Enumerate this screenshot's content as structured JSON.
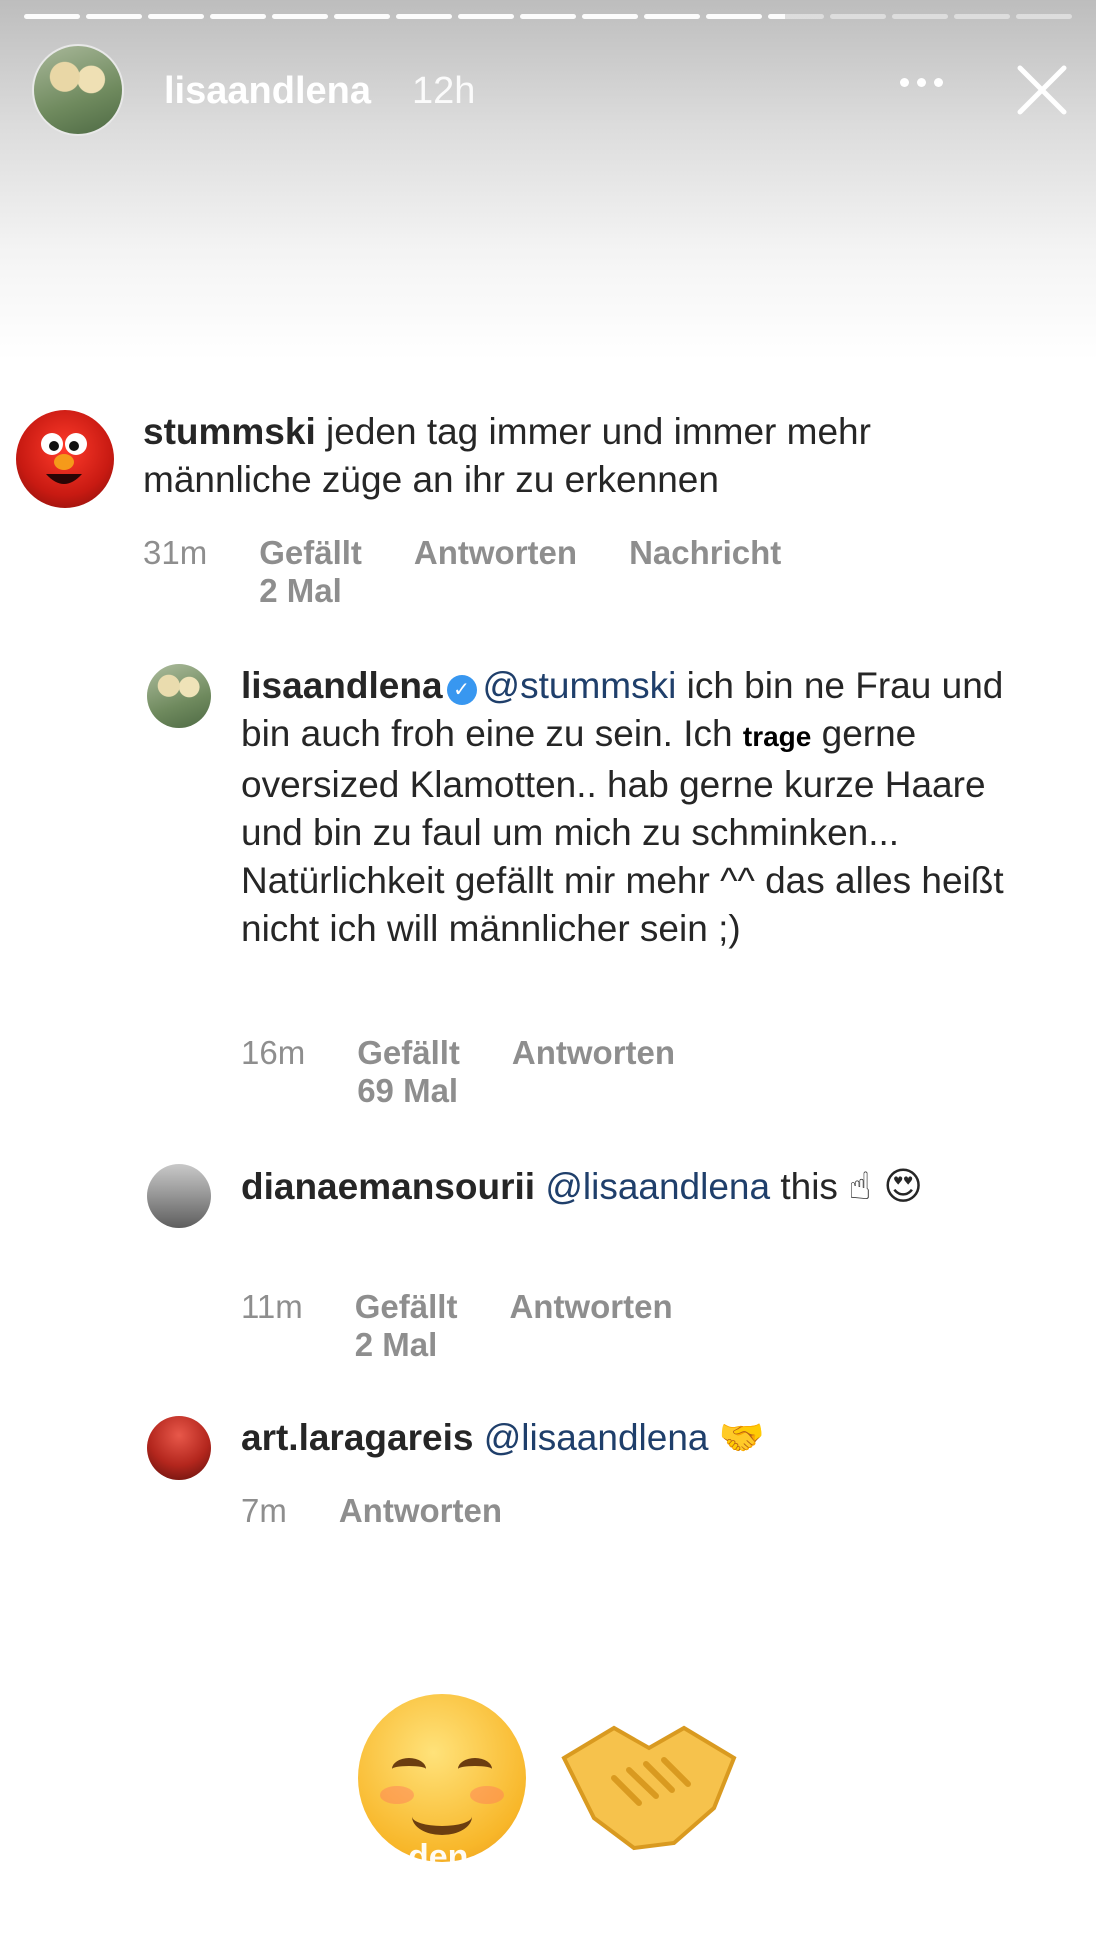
{
  "story": {
    "username": "lisaandlena",
    "time": "12h",
    "segments_total": 17,
    "segments_done": 12
  },
  "comments": [
    {
      "username": "stummski",
      "text": "jeden tag immer und immer mehr männliche züge an ihr zu erkennen",
      "time": "31m",
      "likes": "Gefällt 2 Mal",
      "reply": "Antworten",
      "message": "Nachricht"
    },
    {
      "username": "lisaandlena",
      "mention": "@stummski",
      "text_a": "ich bin ne Frau und bin auch froh eine zu sein. Ich",
      "sticker_word": "trage",
      "text_b": "gerne oversized Klamotten.. hab gerne kurze Haare und bin zu faul um mich zu schminken... Natürlichkeit gefällt mir mehr ^^ das alles heißt nicht ich will männlicher sein ;)",
      "time": "16m",
      "likes": "Gefällt 69 Mal",
      "reply": "Antworten"
    },
    {
      "username": "dianaemansourii",
      "mention": "@lisaandlena",
      "text": "this",
      "emojis": "☝ 😍",
      "time": "11m",
      "likes": "Gefällt 2 Mal",
      "reply": "Antworten"
    },
    {
      "username": "art.laragareis",
      "mention": "@lisaandlena",
      "emojis": "🤝",
      "time": "7m",
      "reply": "Antworten"
    }
  ],
  "stickers": {
    "partial_text": "den"
  },
  "colors": {
    "text": "#262626",
    "meta": "#8e8e8e",
    "mention": "#1f3f6b",
    "verified": "#3897f0"
  }
}
